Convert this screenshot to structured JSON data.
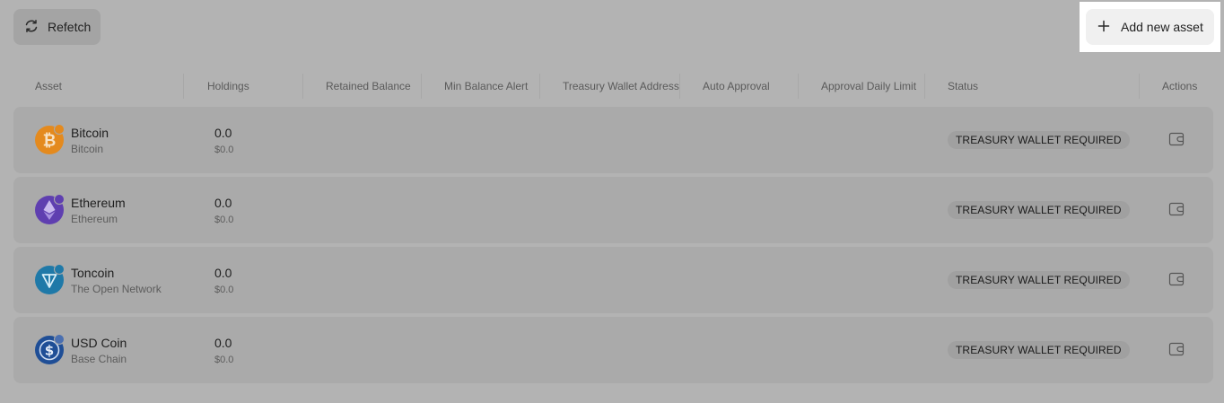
{
  "toolbar": {
    "refetch_label": "Refetch",
    "refetch_icon": "refresh-icon",
    "add_label": "Add new asset",
    "add_icon": "plus-icon"
  },
  "table": {
    "columns": [
      "Asset",
      "Holdings",
      "Retained Balance",
      "Min Balance Alert",
      "Treasury Wallet Address",
      "Auto Approval",
      "Approval Daily Limit",
      "Status",
      "Actions"
    ],
    "rows": [
      {
        "name": "Bitcoin",
        "network": "Bitcoin",
        "amount": "0.0",
        "usd": "$0.0",
        "status": "TREASURY WALLET REQUIRED",
        "icon": "bitcoin-icon",
        "color": "#e48a1e",
        "action_icon": "wallet-icon"
      },
      {
        "name": "Ethereum",
        "network": "Ethereum",
        "amount": "0.0",
        "usd": "$0.0",
        "status": "TREASURY WALLET REQUIRED",
        "icon": "ethereum-icon",
        "color": "#5f3fb0",
        "action_icon": "wallet-icon"
      },
      {
        "name": "Toncoin",
        "network": "The Open Network",
        "amount": "0.0",
        "usd": "$0.0",
        "status": "TREASURY WALLET REQUIRED",
        "icon": "toncoin-icon",
        "color": "#1f79a8",
        "action_icon": "wallet-icon"
      },
      {
        "name": "USD Coin",
        "network": "Base Chain",
        "amount": "0.0",
        "usd": "$0.0",
        "status": "TREASURY WALLET REQUIRED",
        "icon": "usd-coin-icon",
        "color": "#1f4e96",
        "action_icon": "wallet-icon"
      }
    ]
  }
}
